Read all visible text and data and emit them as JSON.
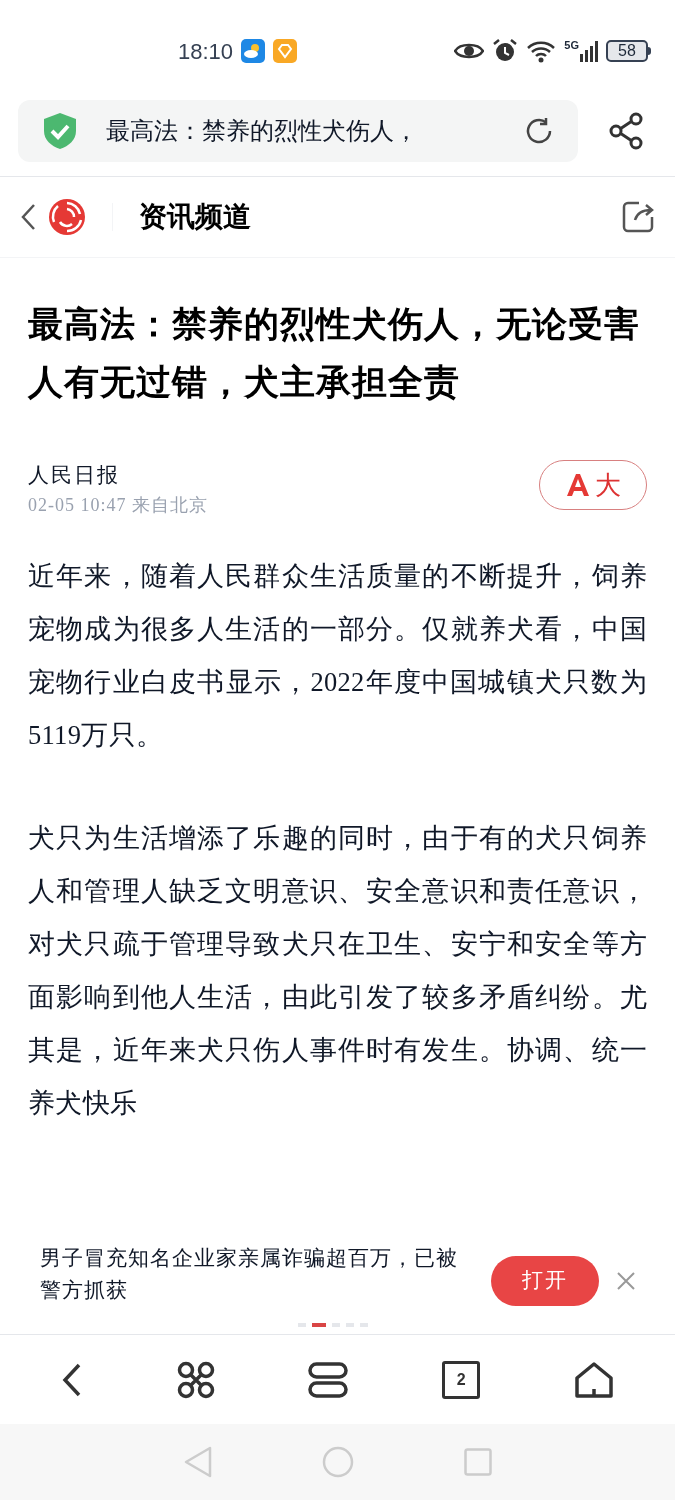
{
  "status_bar": {
    "time": "18:10",
    "network": "5G",
    "battery": "58"
  },
  "address_bar": {
    "text": "最高法：禁养的烈性犬伤人，"
  },
  "channel_bar": {
    "title": "资讯频道"
  },
  "article": {
    "title": "最高法：禁养的烈性犬伤人，无论受害人有无过错，犬主承担全责",
    "source": "人民日报",
    "meta": "02-05 10:47 来自北京",
    "font_button": "大",
    "paragraphs": [
      "近年来，随着人民群众生活质量的不断提升，饲养宠物成为很多人生活的一部分。仅就养犬看，中国宠物行业白皮书显示，2022年度中国城镇犬只数为5119万只。",
      "犬只为生活增添了乐趣的同时，由于有的犬只饲养人和管理人缺乏文明意识、安全意识和责任意识，对犬只疏于管理导致犬只在卫生、安宁和安全等方面影响到他人生活，由此引发了较多矛盾纠纷。尤其是，近年来犬只伤人事件时有发生。协调、统一养犬快乐"
    ]
  },
  "news_banner": {
    "text": "男子冒充知名企业家亲属诈骗超百万，已被警方抓获",
    "button": "打开",
    "dots": [
      {
        "selected": false
      },
      {
        "selected": true
      },
      {
        "selected": false
      },
      {
        "selected": false
      },
      {
        "selected": false
      }
    ]
  },
  "toolbar": {
    "tab_count": "2"
  }
}
